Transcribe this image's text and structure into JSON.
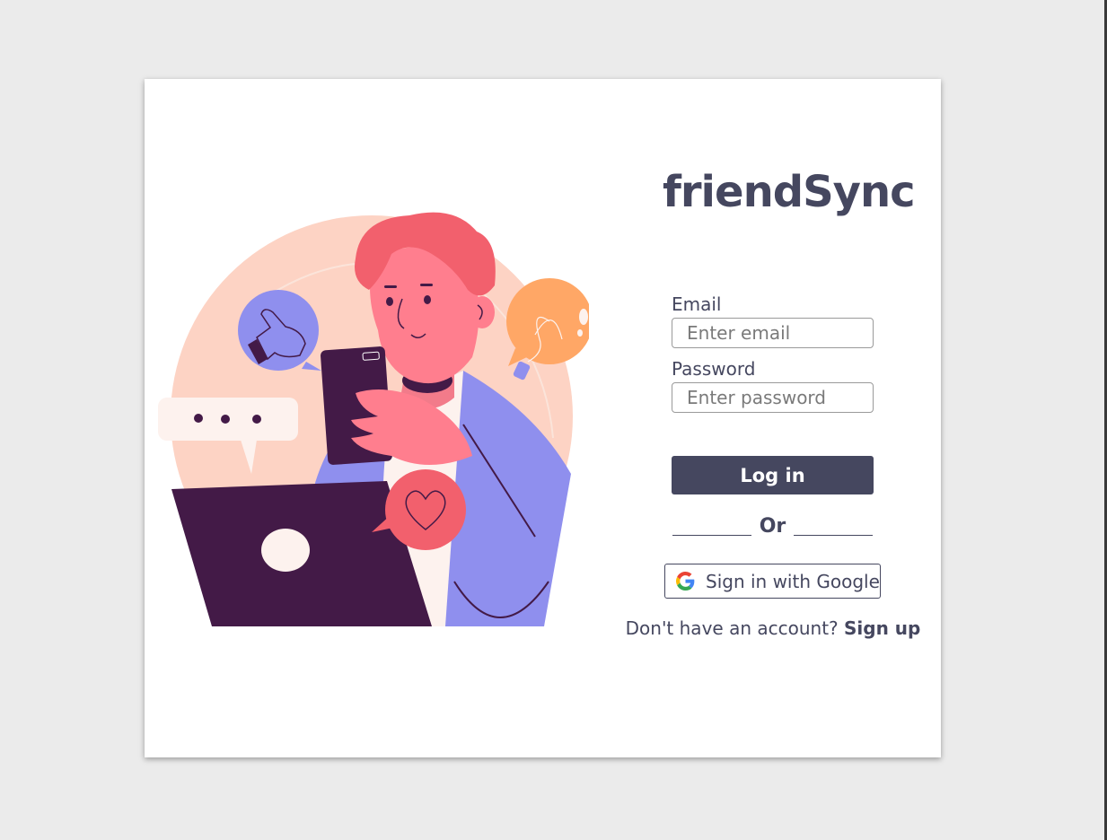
{
  "app": {
    "title": "friendSync"
  },
  "login_form": {
    "email_label": "Email",
    "email_placeholder": "Enter email",
    "email_value": "",
    "password_label": "Password",
    "password_placeholder": "Enter password",
    "password_value": "",
    "submit_label": "Log in",
    "divider_text": "Or",
    "google_label": "Sign in with Google",
    "google_icon": "google-icon"
  },
  "signup": {
    "prompt": "Don't have an account?",
    "link_label": "Sign up"
  },
  "illustration": {
    "icon": "person-with-phone-illustration"
  },
  "colors": {
    "primary": "#45475f",
    "peach": "#fdd3c4",
    "coral": "#f2606d",
    "lavender": "#8f8fee",
    "plum": "#431a47",
    "orange": "#ffa766"
  }
}
